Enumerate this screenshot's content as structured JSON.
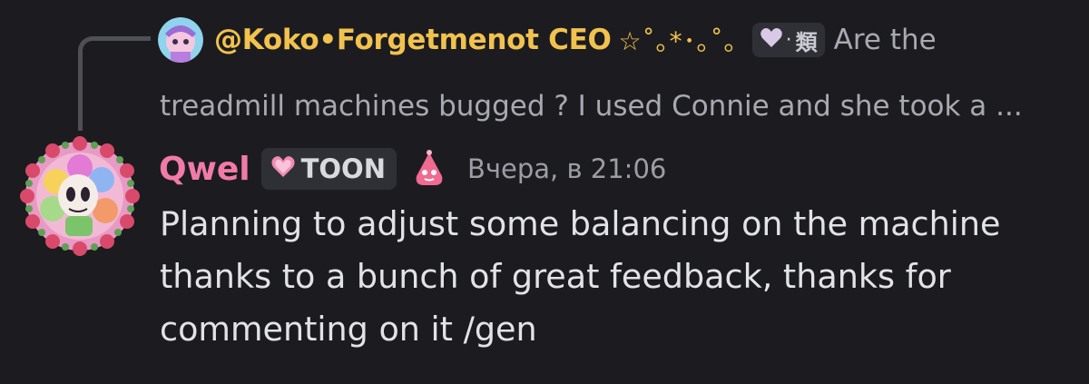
{
  "reply": {
    "author": "@Koko•Forgetmenot CEO",
    "decoration": "☆˚｡*･｡˚｡",
    "tag_text": "類",
    "snippet_line1": "Are the",
    "snippet_line2": "treadmill machines bugged ? I used Connie and she took a ..."
  },
  "message": {
    "author": "Qwel",
    "role_tag": "TOON",
    "timestamp": "Вчера, в 21:06",
    "lines": [
      "Planning to adjust some balancing on the machine",
      "thanks to a bunch of great feedback, thanks for",
      "commenting on it /gen"
    ]
  },
  "icons": {
    "reply_tag_icon": "heart-icon",
    "role_tag_icon": "pink-heart-icon",
    "role_badge_icon": "pink-drop-badge-icon"
  },
  "colors": {
    "background": "#1c1c20",
    "reply_author": "#f1c24e",
    "author": "#f17aa8",
    "text": "#e2e3e8",
    "muted": "#a8a9b1"
  }
}
